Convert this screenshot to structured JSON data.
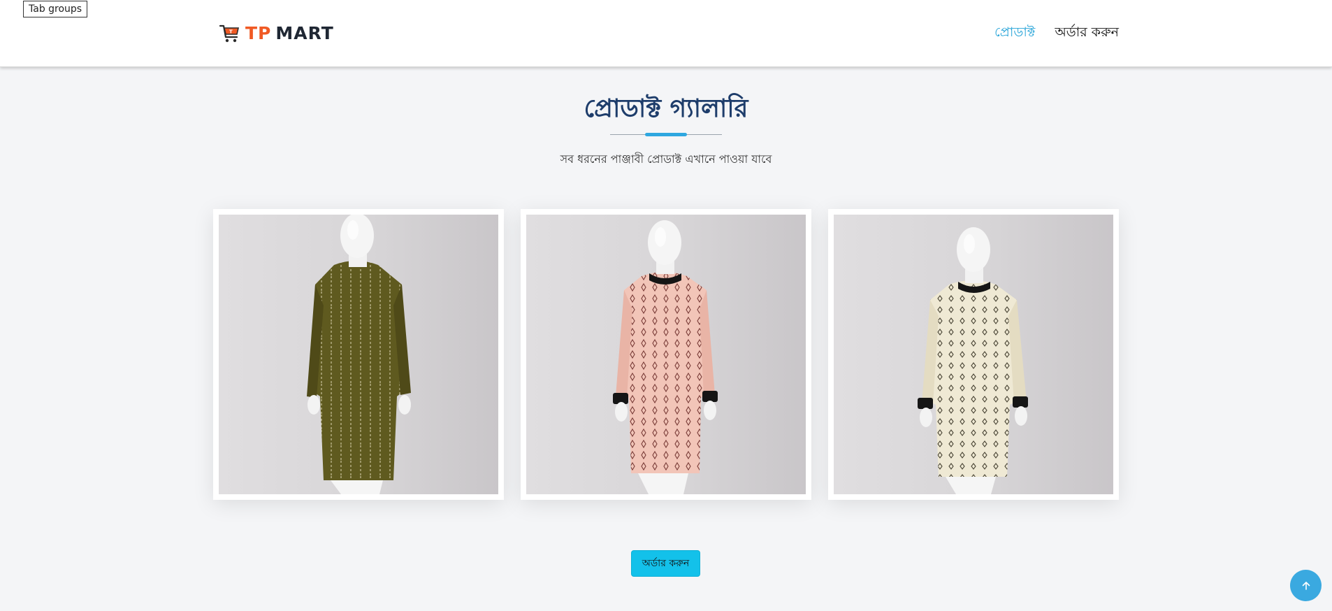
{
  "tooltip": {
    "text": "Tab groups"
  },
  "brand": {
    "part1": "TP",
    "part2": "MART",
    "icon": "shopping-cart-icon"
  },
  "nav": {
    "products": "প্রোডাক্ট",
    "order": "অর্ডার করুন"
  },
  "gallery": {
    "title": "প্রোডাক্ট গ্যালারি",
    "subtitle": "সব ধরনের পাঞ্জাবী প্রোডাক্ট এখানে পাওয়া যাবে",
    "items": [
      {
        "color": "#5f5a1f",
        "pattern": "#c9c29a"
      },
      {
        "color": "#f2c5b8",
        "pattern": "#7a3c38"
      },
      {
        "color": "#efe9d4",
        "pattern": "#4a4536"
      }
    ]
  },
  "order_button": {
    "label": "অর্ডার করুন"
  },
  "scroll_top": {
    "icon": "arrow-up-icon"
  },
  "colors": {
    "accent": "#25a3d8",
    "button": "#13c1ea",
    "heading": "#1e3d6b",
    "logo_orange": "#f05a24"
  }
}
